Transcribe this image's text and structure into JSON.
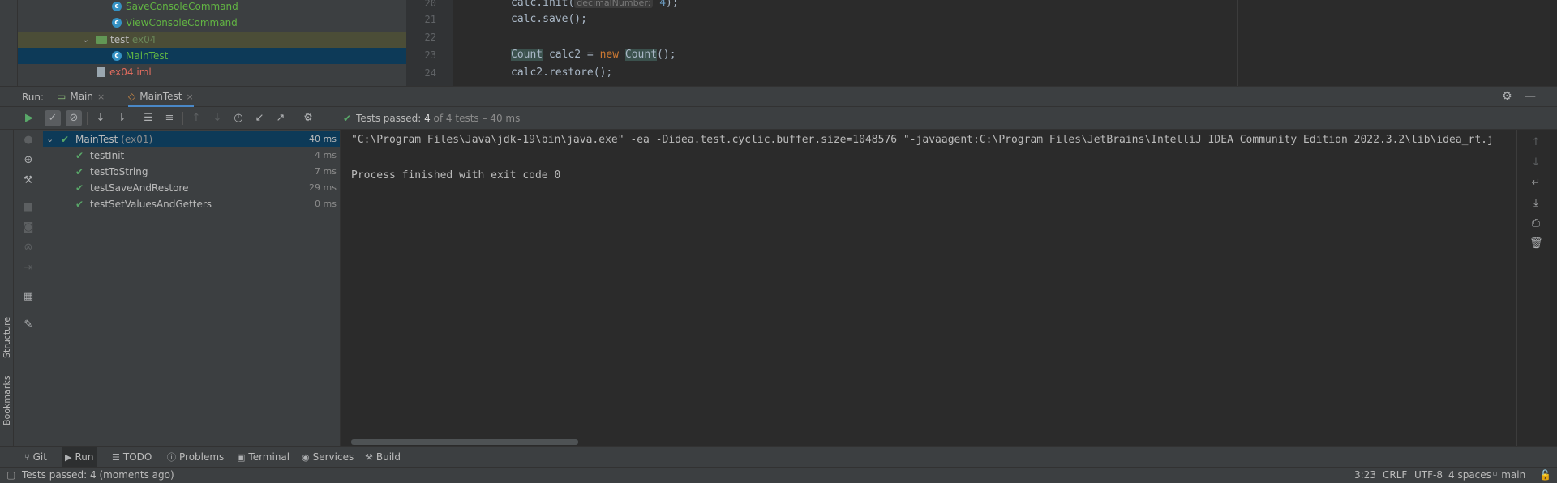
{
  "project_tree": {
    "items": [
      {
        "label": "SaveConsoleCommand",
        "icon": "class-icon"
      },
      {
        "label": "ViewConsoleCommand",
        "icon": "class-icon"
      },
      {
        "label": "test",
        "sub": "ex04",
        "icon": "folder-icon"
      },
      {
        "label": "MainTest",
        "icon": "class-icon"
      },
      {
        "label": "ex04.iml",
        "icon": "module-file-icon"
      }
    ]
  },
  "editor": {
    "line_numbers": [
      "20",
      "21",
      "22",
      "23",
      "24"
    ],
    "lines": {
      "l20a": "calc.init(",
      "l20hint": "decimalNumber:",
      "l20b": "4",
      "l20c": ");",
      "l21": "calc.save();",
      "l23a": "Count",
      "l23b": " calc2 = ",
      "l23c": "new",
      "l23d": "Count",
      "l23e": "();",
      "l24": "calc2.restore();"
    }
  },
  "run_panel": {
    "label": "Run:",
    "tabs": [
      {
        "label": "Main",
        "icon": "run-config-icon"
      },
      {
        "label": "MainTest",
        "icon": "junit-icon",
        "active": true
      }
    ],
    "status": {
      "prefix": "Tests passed: ",
      "count": "4",
      "suffix": " of 4 tests – 40 ms"
    }
  },
  "test_tree": {
    "root": {
      "name": "MainTest",
      "sub": "(ex01)",
      "time": "40 ms"
    },
    "tests": [
      {
        "name": "testInit",
        "time": "4 ms"
      },
      {
        "name": "testToString",
        "time": "7 ms"
      },
      {
        "name": "testSaveAndRestore",
        "time": "29 ms"
      },
      {
        "name": "testSetValuesAndGetters",
        "time": "0 ms"
      }
    ]
  },
  "console": {
    "line1": "\"C:\\Program Files\\Java\\jdk-19\\bin\\java.exe\" -ea -Didea.test.cyclic.buffer.size=1048576 \"-javaagent:C:\\Program Files\\JetBrains\\IntelliJ IDEA Community Edition 2022.3.2\\lib\\idea_rt.j",
    "line2": "Process finished with exit code 0"
  },
  "side_labels": {
    "structure": "Structure",
    "bookmarks": "Bookmarks"
  },
  "tool_windows": [
    {
      "label": "Git",
      "icon": "git-icon"
    },
    {
      "label": "Run",
      "icon": "run-icon",
      "active": true
    },
    {
      "label": "TODO",
      "icon": "todo-icon"
    },
    {
      "label": "Problems",
      "icon": "problems-icon"
    },
    {
      "label": "Terminal",
      "icon": "terminal-icon"
    },
    {
      "label": "Services",
      "icon": "services-icon"
    },
    {
      "label": "Build",
      "icon": "build-icon"
    }
  ],
  "status_bar": {
    "message": "Tests passed: 4 (moments ago)",
    "position": "3:23",
    "line_sep": "CRLF",
    "encoding": "UTF-8",
    "indent": "4 spaces",
    "branch": "main"
  },
  "colors": {
    "accent": "#4a88c7",
    "pass": "#59a869",
    "selection": "#0d3a58"
  }
}
